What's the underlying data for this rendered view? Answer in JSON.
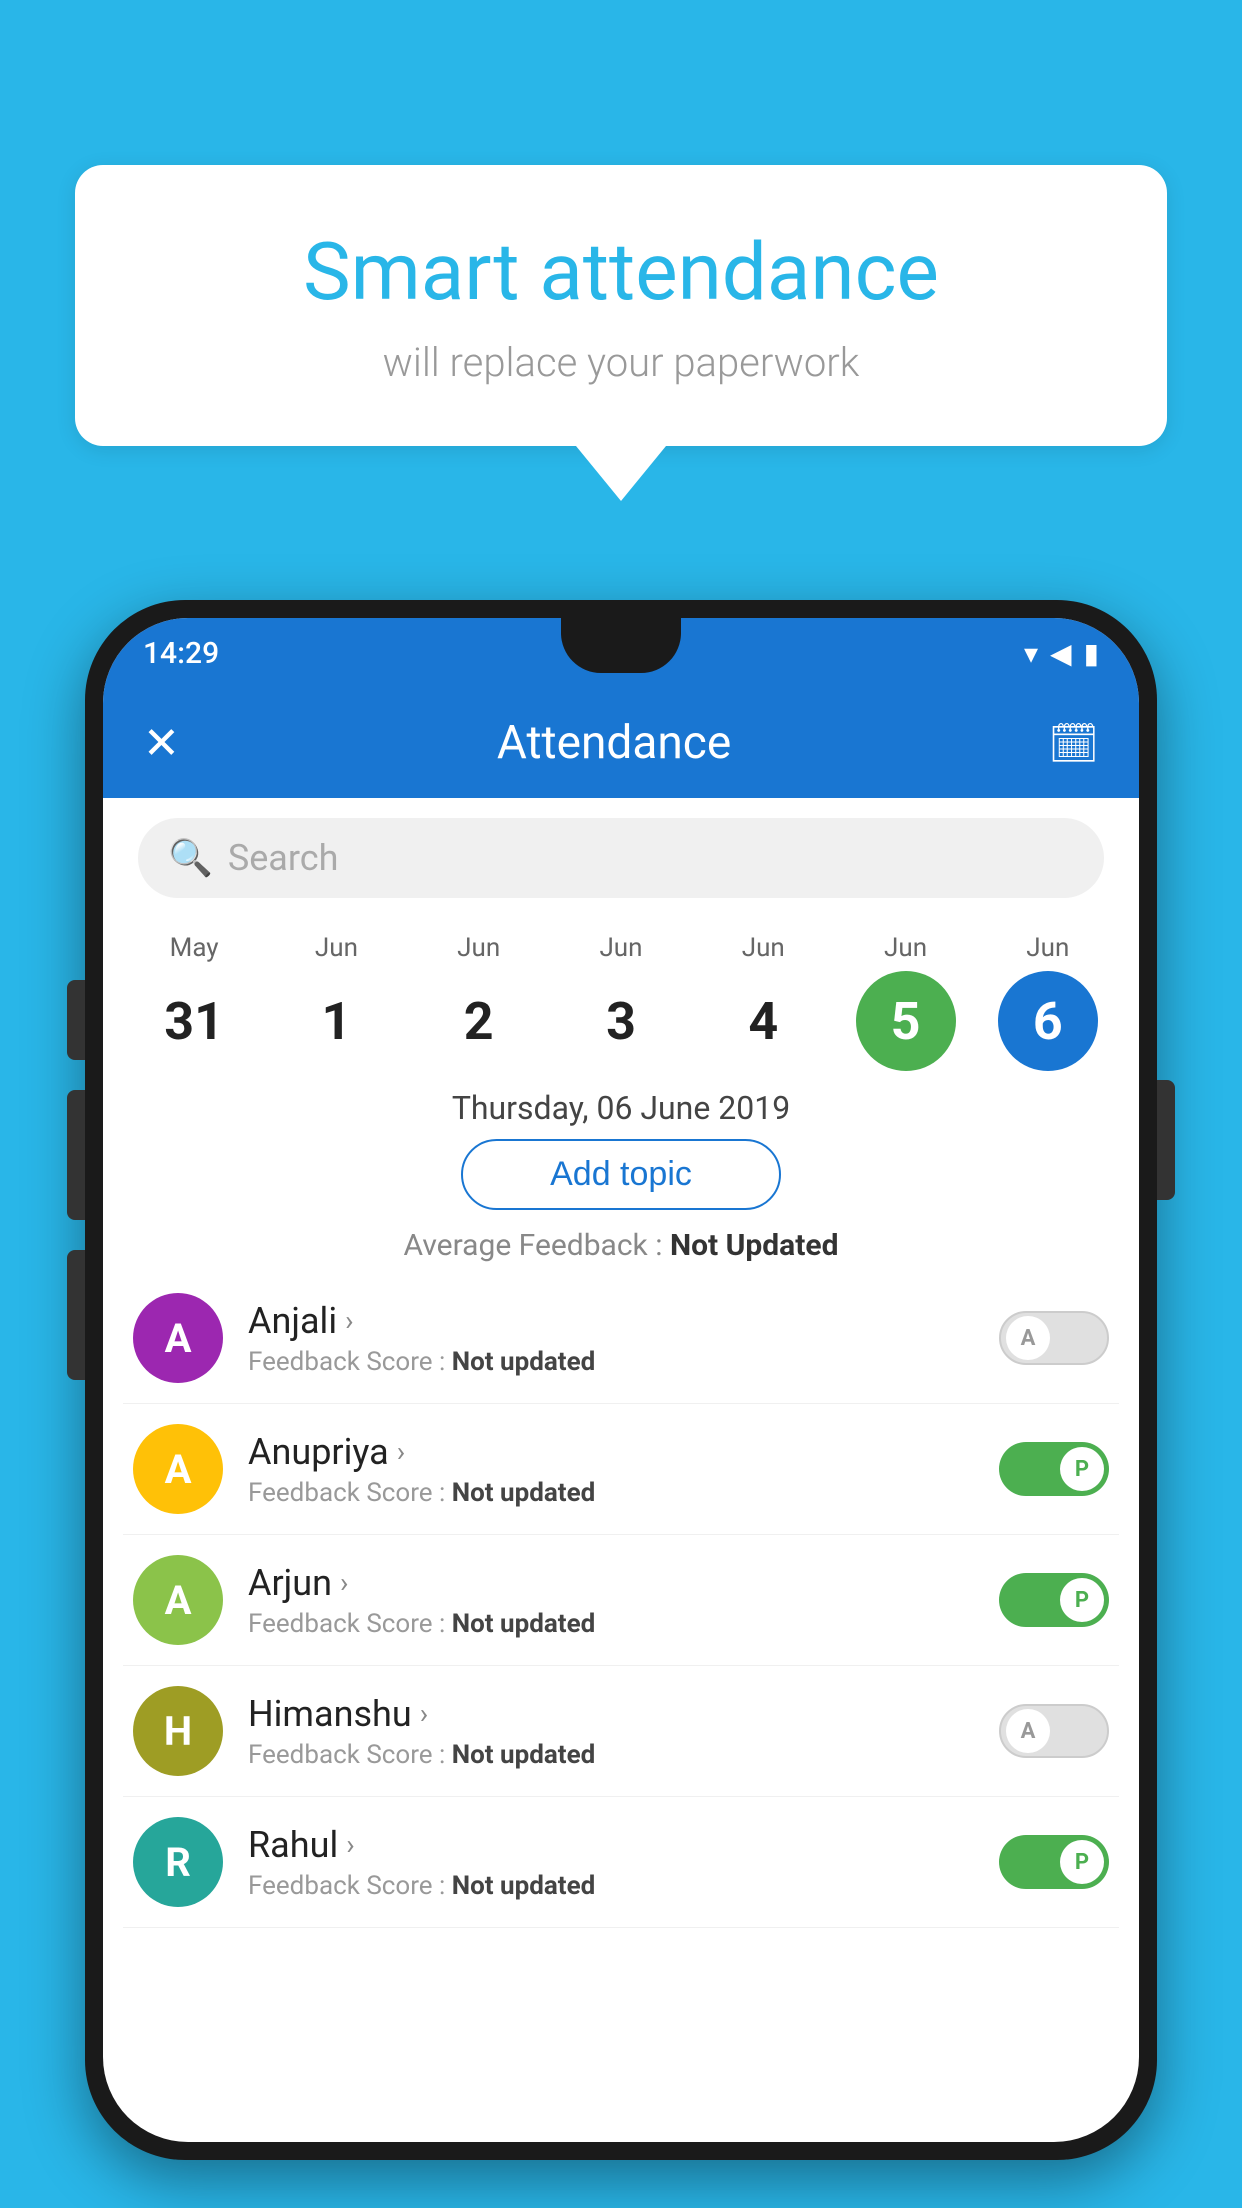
{
  "background_color": "#29B6E8",
  "speech_bubble": {
    "title": "Smart attendance",
    "subtitle": "will replace your paperwork"
  },
  "status_bar": {
    "time": "14:29",
    "icons": [
      "▾",
      "◀",
      "▮"
    ]
  },
  "app_bar": {
    "close_icon": "✕",
    "title": "Attendance",
    "calendar_icon": "📅"
  },
  "search": {
    "placeholder": "Search"
  },
  "calendar": {
    "days": [
      {
        "month": "May",
        "num": "31",
        "state": "normal"
      },
      {
        "month": "Jun",
        "num": "1",
        "state": "normal"
      },
      {
        "month": "Jun",
        "num": "2",
        "state": "normal"
      },
      {
        "month": "Jun",
        "num": "3",
        "state": "normal"
      },
      {
        "month": "Jun",
        "num": "4",
        "state": "normal"
      },
      {
        "month": "Jun",
        "num": "5",
        "state": "today"
      },
      {
        "month": "Jun",
        "num": "6",
        "state": "selected"
      }
    ]
  },
  "selected_date": "Thursday, 06 June 2019",
  "add_topic_label": "Add topic",
  "avg_feedback_label": "Average Feedback :",
  "avg_feedback_value": "Not Updated",
  "students": [
    {
      "name": "Anjali",
      "avatar_letter": "A",
      "avatar_color": "purple",
      "feedback_label": "Feedback Score :",
      "feedback_value": "Not updated",
      "toggle_state": "off",
      "toggle_label": "A"
    },
    {
      "name": "Anupriya",
      "avatar_letter": "A",
      "avatar_color": "yellow",
      "feedback_label": "Feedback Score :",
      "feedback_value": "Not updated",
      "toggle_state": "on",
      "toggle_label": "P"
    },
    {
      "name": "Arjun",
      "avatar_letter": "A",
      "avatar_color": "green-light",
      "feedback_label": "Feedback Score :",
      "feedback_value": "Not updated",
      "toggle_state": "on",
      "toggle_label": "P"
    },
    {
      "name": "Himanshu",
      "avatar_letter": "H",
      "avatar_color": "olive",
      "feedback_label": "Feedback Score :",
      "feedback_value": "Not updated",
      "toggle_state": "off",
      "toggle_label": "A"
    },
    {
      "name": "Rahul",
      "avatar_letter": "R",
      "avatar_color": "teal",
      "feedback_label": "Feedback Score :",
      "feedback_value": "Not updated",
      "toggle_state": "on",
      "toggle_label": "P"
    }
  ]
}
